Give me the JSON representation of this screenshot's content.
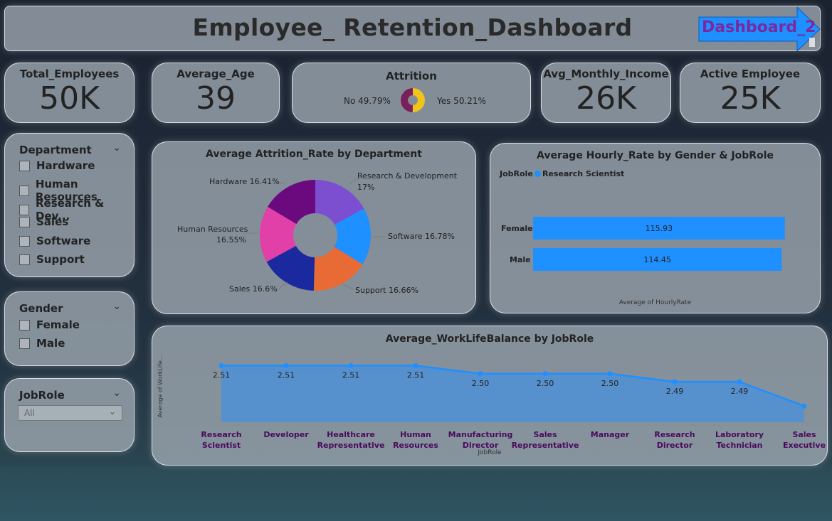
{
  "title": "Employee_ Retention_Dashboard",
  "nav_button": "Dashboard_2",
  "kpis": {
    "total_employees": {
      "label": "Total_Employees",
      "value": "50K"
    },
    "average_age": {
      "label": "Average_Age",
      "value": "39"
    },
    "attrition": {
      "label": "Attrition",
      "no_label": "No 49.79%",
      "yes_label": "Yes 50.21%",
      "no_pct": 49.79,
      "yes_pct": 50.21,
      "no_color": "#7b1f5a",
      "yes_color": "#f0c419"
    },
    "avg_monthly_income": {
      "label": "Avg_Monthly_Income",
      "value": "26K"
    },
    "active_employee": {
      "label": "Active Employee",
      "value": "25K"
    }
  },
  "slicers": {
    "department": {
      "label": "Department",
      "options": [
        "Hardware",
        "Human Resources",
        "Research & Dev...",
        "Sales",
        "Software",
        "Support"
      ]
    },
    "gender": {
      "label": "Gender",
      "options": [
        "Female",
        "Male"
      ]
    },
    "jobrole": {
      "label": "JobRole",
      "selected": "All"
    }
  },
  "chart_data": [
    {
      "type": "pie",
      "title": "Average Attrition_Rate by Department",
      "categories": [
        "Research & Development",
        "Software",
        "Support",
        "Sales",
        "Human Resources",
        "Hardware"
      ],
      "values": [
        17,
        16.78,
        16.66,
        16.6,
        16.55,
        16.41
      ],
      "labels": [
        "Research & Development",
        "17%",
        "Software 16.78%",
        "Support 16.66%",
        "Sales 16.6%",
        "Human Resources",
        "16.55%",
        "Hardware 16.41%"
      ],
      "colors": [
        "#7b4fd0",
        "#1e90ff",
        "#e86a35",
        "#1a2a9e",
        "#e040a8",
        "#6a0a7e"
      ],
      "donut": true
    },
    {
      "type": "bar",
      "orientation": "horizontal",
      "title": "Average Hourly_Rate by Gender & JobRole",
      "legend_title": "JobRole",
      "legend": "top-left",
      "categories": [
        "Female",
        "Male"
      ],
      "series": [
        {
          "name": "Research Scientist",
          "values": [
            115.93,
            114.45
          ],
          "color": "#1e90ff"
        }
      ],
      "xlabel": "Average of HourlyRate",
      "ylabel": ""
    },
    {
      "type": "area",
      "title": "Average_WorkLifeBalance by JobRole",
      "x": [
        "Research Scientist",
        "Developer",
        "Healthcare Representative",
        "Human Resources",
        "Manufacturing Director",
        "Sales Representative",
        "Manager",
        "Research Director",
        "Laboratory Technician",
        "Sales Executive"
      ],
      "x_lines": [
        [
          "Research",
          "Scientist"
        ],
        [
          "Developer"
        ],
        [
          "Healthcare",
          "Representative"
        ],
        [
          "Human",
          "Resources"
        ],
        [
          "Manufacturing",
          "Director"
        ],
        [
          "Sales",
          "Representative"
        ],
        [
          "Manager"
        ],
        [
          "Research",
          "Director"
        ],
        [
          "Laboratory",
          "Technician"
        ],
        [
          "Sales",
          "Executive"
        ]
      ],
      "values": [
        2.51,
        2.51,
        2.51,
        2.51,
        2.5,
        2.5,
        2.5,
        2.49,
        2.49,
        2.46
      ],
      "data_labels": [
        "2.51",
        "2.51",
        "2.51",
        "2.51",
        "2.50",
        "2.50",
        "2.50",
        "2.49",
        "2.49",
        ""
      ],
      "xlabel": "JobRole",
      "ylabel": "Average of WorkLife...",
      "line_color": "#1e90ff",
      "fill_color": "#4d8fd6",
      "xlabel_color": "#4a0a5e"
    }
  ]
}
